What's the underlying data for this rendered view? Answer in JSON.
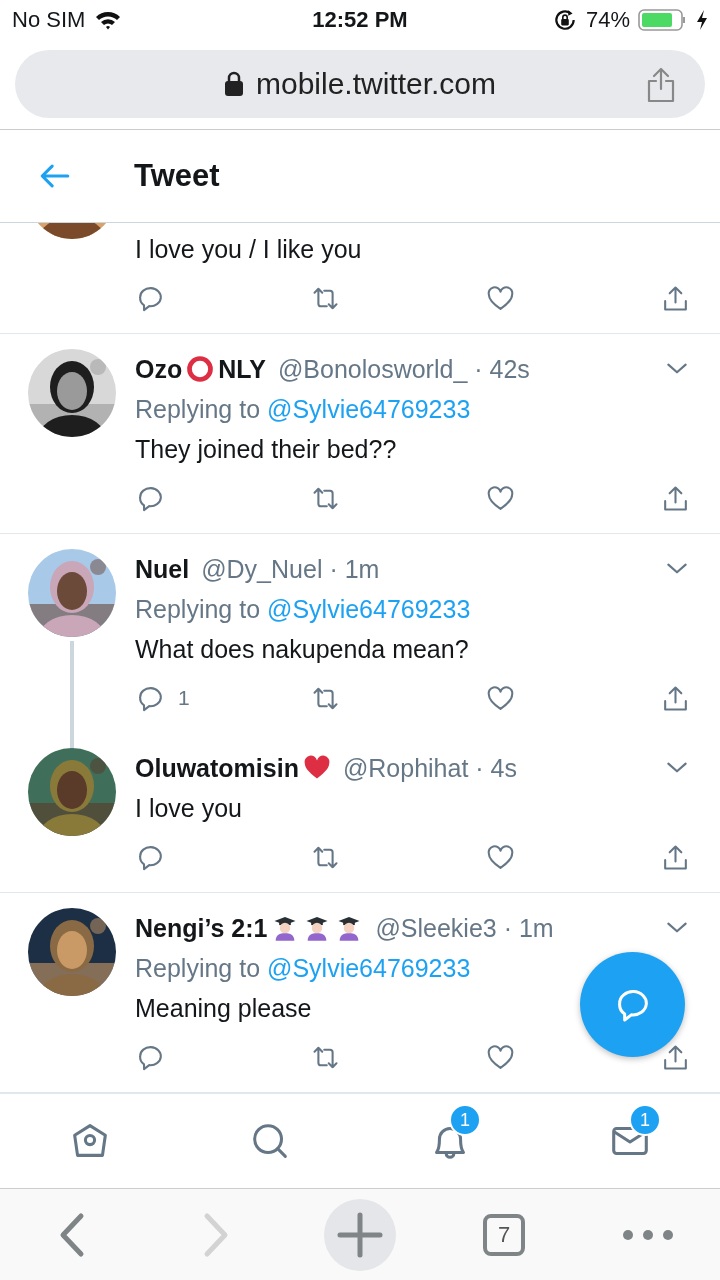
{
  "status_bar": {
    "carrier": "No SIM",
    "time": "12:52 PM",
    "battery": "74%"
  },
  "address_bar": {
    "url": "mobile.twitter.com"
  },
  "header": {
    "title": "Tweet"
  },
  "tweets": [
    {
      "avatar": {
        "kind": "picture"
      },
      "partial": true,
      "text": "I love you / I like you",
      "connected_below": false
    },
    {
      "avatar": {
        "kind": "picture"
      },
      "name": [
        {
          "kind": "text",
          "text": "Ozo"
        },
        {
          "kind": "ring"
        },
        {
          "kind": "text",
          "text": "NLY"
        }
      ],
      "meta": "@Bonolosworld_ · 42s",
      "replying_label": "Replying to",
      "replying_to": "@Sylvie64769233",
      "text": "They joined their bed??",
      "partial": false,
      "connected_below": false
    },
    {
      "avatar": {
        "kind": "picture"
      },
      "name": [
        {
          "kind": "text",
          "text": "Nuel"
        }
      ],
      "meta": "@Dy_Nuel · 1m",
      "replying_label": "Replying to",
      "replying_to": "@Sylvie64769233",
      "text": "What does nakupenda mean?",
      "reply_count": "1",
      "partial": false,
      "connected_below": true
    },
    {
      "avatar": {
        "kind": "picture"
      },
      "name": [
        {
          "kind": "text",
          "text": "Oluwatomisin"
        },
        {
          "kind": "heart"
        }
      ],
      "meta": "@Rophihat · 4s",
      "text": "I love you",
      "partial": false,
      "connected_below": false
    },
    {
      "avatar": {
        "kind": "picture"
      },
      "name": [
        {
          "kind": "text",
          "text": "Nengi’s 2:1"
        },
        {
          "kind": "graduate"
        },
        {
          "kind": "graduate"
        },
        {
          "kind": "graduate"
        }
      ],
      "meta": "@Sleekie3 · 1m",
      "replying_label": "Replying to",
      "replying_to": "@Sylvie64769233",
      "text": "Meaning please",
      "partial": false,
      "connected_below": false
    }
  ],
  "bottom_nav": [
    {
      "kind": "home"
    },
    {
      "kind": "search"
    },
    {
      "kind": "bell",
      "badge": "1"
    },
    {
      "kind": "mail",
      "badge": "1"
    }
  ],
  "browser_toolbar": [
    {
      "kind": "back",
      "disabled": false
    },
    {
      "kind": "forward",
      "disabled": true
    },
    {
      "kind": "new-tab",
      "disabled": false
    },
    {
      "kind": "tabs",
      "label": "7",
      "disabled": false
    },
    {
      "kind": "more",
      "disabled": false
    }
  ]
}
